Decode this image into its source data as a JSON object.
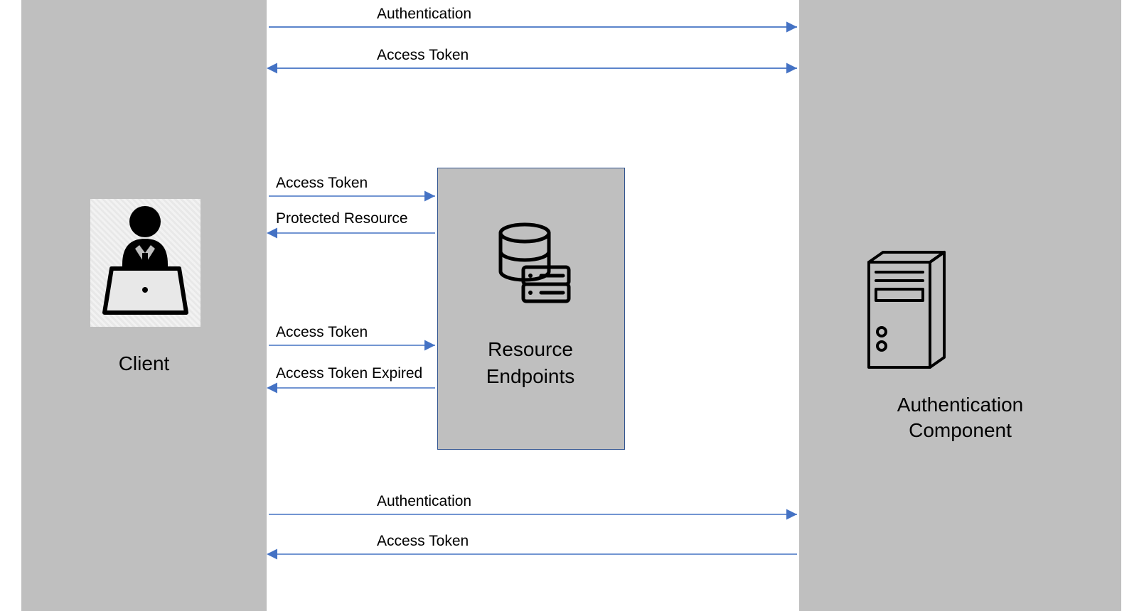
{
  "client": {
    "label": "Client"
  },
  "auth_component": {
    "label_line1": "Authentication",
    "label_line2": "Component"
  },
  "resource": {
    "label_line1": "Resource",
    "label_line2": "Endpoints"
  },
  "flows": {
    "top_auth": {
      "label": "Authentication"
    },
    "top_token": {
      "label": "Access Token"
    },
    "mid1_req": {
      "label": "Access Token"
    },
    "mid1_resp": {
      "label": "Protected Resource"
    },
    "mid2_req": {
      "label": "Access Token"
    },
    "mid2_resp": {
      "label": "Access Token Expired"
    },
    "bottom_auth": {
      "label": "Authentication"
    },
    "bottom_token": {
      "label": "Access Token"
    }
  }
}
